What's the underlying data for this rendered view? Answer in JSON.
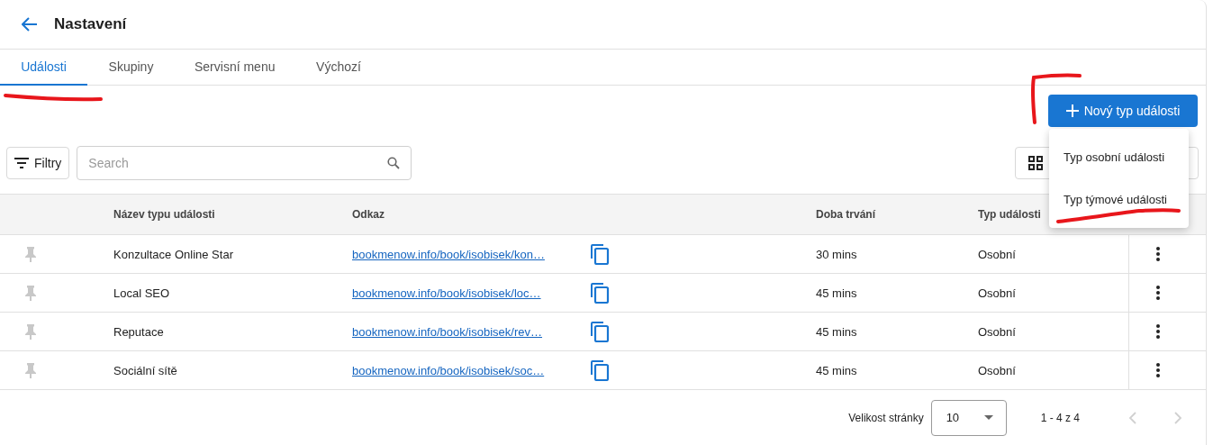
{
  "header": {
    "title": "Nastavení"
  },
  "tabs": [
    {
      "label": "Události",
      "selected": true
    },
    {
      "label": "Skupiny",
      "selected": false
    },
    {
      "label": "Servisní menu",
      "selected": false
    },
    {
      "label": "Výchozí",
      "selected": false
    }
  ],
  "new_button": {
    "label": "Nový typ události"
  },
  "menu": {
    "items": [
      "Typ osobní události",
      "Typ týmové události"
    ]
  },
  "filter_button": {
    "label": "Filtry"
  },
  "search": {
    "placeholder": "Search"
  },
  "table": {
    "columns": [
      "Název typu události",
      "Odkaz",
      "Doba trvání",
      "Typ události"
    ],
    "rows": [
      {
        "name": "Konzultace Online Star",
        "link": "bookmenow.info/book/isobisek/kon…",
        "duration": "30 mins",
        "type": "Osobní"
      },
      {
        "name": "Local SEO",
        "link": "bookmenow.info/book/isobisek/loc…",
        "duration": "45 mins",
        "type": "Osobní"
      },
      {
        "name": "Reputace",
        "link": "bookmenow.info/book/isobisek/rev…",
        "duration": "45 mins",
        "type": "Osobní"
      },
      {
        "name": "Sociální sítě",
        "link": "bookmenow.info/book/isobisek/soc…",
        "duration": "45 mins",
        "type": "Osobní"
      }
    ]
  },
  "pagination": {
    "page_size_label": "Velikost stránky",
    "page_size": "10",
    "range": "1 - 4 z 4",
    "prev_disabled": true,
    "next_disabled": true
  }
}
